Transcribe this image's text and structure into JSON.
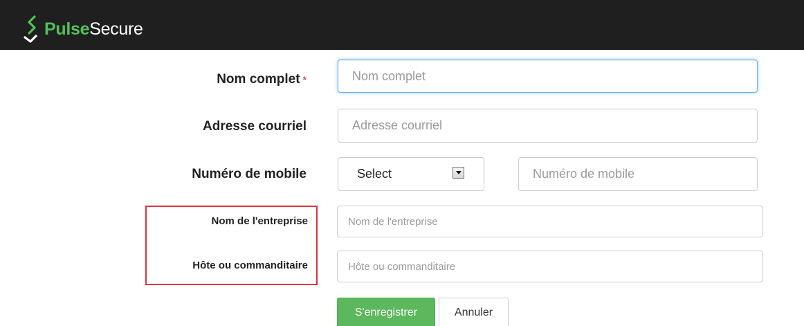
{
  "header": {
    "logo_part1": "Pulse",
    "logo_part2": "Secure",
    "logo_icon": "pulse-secure-s-icon",
    "background_color": "#1f1f1f",
    "brand_color": "#52c15a"
  },
  "form": {
    "full_name": {
      "label": "Nom complet",
      "required_mark": "*",
      "placeholder": "Nom complet",
      "value": ""
    },
    "email": {
      "label": "Adresse courriel",
      "placeholder": "Adresse courriel",
      "value": ""
    },
    "mobile": {
      "label": "Numéro de mobile",
      "select_value": "Select",
      "placeholder": "Numéro de mobile",
      "value": ""
    },
    "company": {
      "label": "Nom de l'entreprise",
      "placeholder": "Nom de l'entreprise",
      "value": ""
    },
    "host": {
      "label": "Hôte ou commanditaire",
      "placeholder": "Hôte ou commanditaire",
      "value": ""
    }
  },
  "actions": {
    "register_label": "S'enregistrer",
    "cancel_label": "Annuler",
    "register_color": "#5cb85c"
  },
  "highlight": {
    "color": "#d9363e"
  }
}
